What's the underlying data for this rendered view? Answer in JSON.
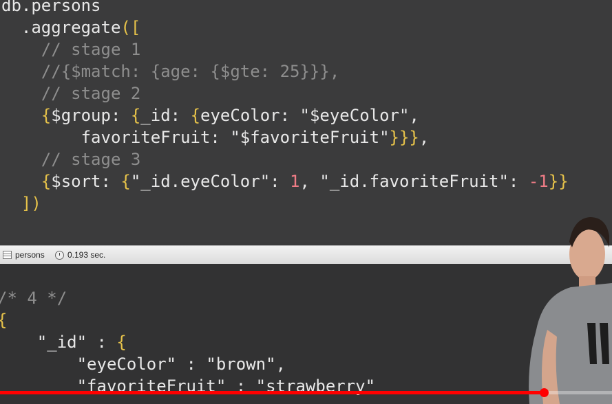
{
  "editor": {
    "lines": [
      {
        "parts": [
          {
            "t": "db.persons",
            "c": "c-key"
          }
        ]
      },
      {
        "parts": [
          {
            "t": "  .aggregate",
            "c": "c-key"
          },
          {
            "t": "([",
            "c": "c-bracket"
          }
        ]
      },
      {
        "parts": [
          {
            "t": "    // stage 1",
            "c": "c-comment"
          }
        ]
      },
      {
        "parts": [
          {
            "t": "    //{$match: {age: {$gte: 25}}},",
            "c": "c-comment"
          }
        ]
      },
      {
        "parts": [
          {
            "t": "    // stage 2",
            "c": "c-comment"
          }
        ]
      },
      {
        "parts": [
          {
            "t": "    {",
            "c": "c-bracket"
          },
          {
            "t": "$group: ",
            "c": "c-key"
          },
          {
            "t": "{",
            "c": "c-bracket"
          },
          {
            "t": "_id",
            "c": "c-key"
          },
          {
            "t": ": ",
            "c": "c-key"
          },
          {
            "t": "{",
            "c": "c-bracket"
          },
          {
            "t": "eyeColor: \"$eyeColor\",",
            "c": "c-str"
          }
        ]
      },
      {
        "parts": [
          {
            "t": "        favoriteFruit: \"$favoriteFruit\"",
            "c": "c-str"
          },
          {
            "t": "}}}",
            "c": "c-bracket"
          },
          {
            "t": ",",
            "c": "c-key"
          }
        ]
      },
      {
        "parts": [
          {
            "t": "    // stage 3",
            "c": "c-comment"
          }
        ]
      },
      {
        "parts": [
          {
            "t": "    {",
            "c": "c-bracket"
          },
          {
            "t": "$sort: ",
            "c": "c-key"
          },
          {
            "t": "{",
            "c": "c-bracket"
          },
          {
            "t": "\"_id.eyeColor\": ",
            "c": "c-str"
          },
          {
            "t": "1",
            "c": "c-num"
          },
          {
            "t": ", \"_id.favoriteFruit\": ",
            "c": "c-str"
          },
          {
            "t": "-1",
            "c": "c-num"
          },
          {
            "t": "}}",
            "c": "c-bracket"
          }
        ]
      },
      {
        "parts": [
          {
            "t": "  ])",
            "c": "c-bracket"
          }
        ]
      }
    ]
  },
  "statusbar": {
    "collection": "persons",
    "time": "0.193 sec."
  },
  "results": {
    "lines": [
      {
        "parts": [
          {
            "t": "/* 4 */",
            "c": "c-comment"
          }
        ]
      },
      {
        "parts": [
          {
            "t": "{",
            "c": "c-bracket"
          }
        ]
      },
      {
        "parts": [
          {
            "t": "    \"_id\" : ",
            "c": "c-str"
          },
          {
            "t": "{",
            "c": "c-bracket"
          }
        ]
      },
      {
        "parts": [
          {
            "t": "        \"eyeColor\" : \"brown\",",
            "c": "c-str"
          }
        ]
      },
      {
        "parts": [
          {
            "t": "        \"favoriteFruit\" : \"strawberry\"",
            "c": "c-str"
          }
        ]
      }
    ]
  },
  "video": {
    "progress": 0.889
  }
}
